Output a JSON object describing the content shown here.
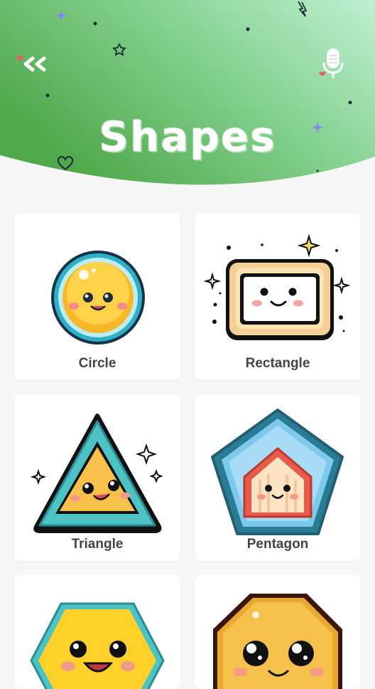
{
  "header": {
    "title": "Shapes",
    "back_icon": "double-chevron-left-icon",
    "mic_icon": "microphone-icon",
    "gradient_colors": [
      "#4fa84a",
      "#a9e8c0"
    ]
  },
  "shapes": [
    {
      "label": "Circle",
      "icon": "circle-face-icon"
    },
    {
      "label": "Rectangle",
      "icon": "rectangle-face-icon"
    },
    {
      "label": "Triangle",
      "icon": "triangle-face-icon"
    },
    {
      "label": "Pentagon",
      "icon": "pentagon-house-icon"
    },
    {
      "label": "",
      "icon": "hexagon-face-icon"
    },
    {
      "label": "",
      "icon": "octagon-face-icon"
    }
  ]
}
